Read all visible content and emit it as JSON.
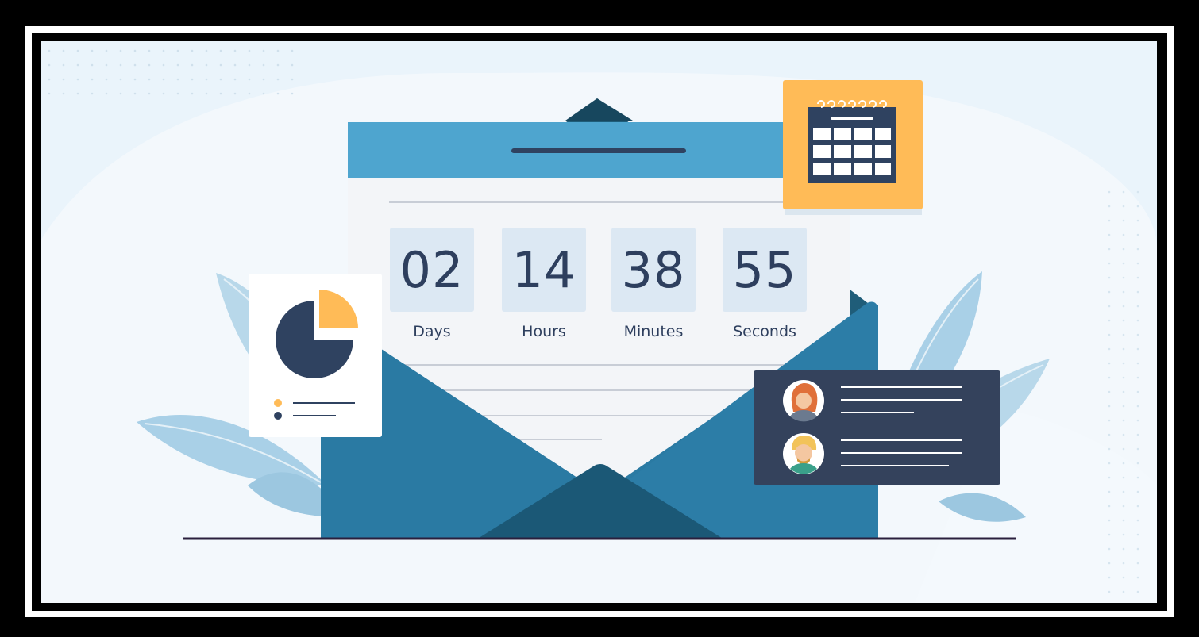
{
  "countdown": {
    "days": {
      "value": "02",
      "label": "Days"
    },
    "hours": {
      "value": "14",
      "label": "Hours"
    },
    "minutes": {
      "value": "38",
      "label": "Minutes"
    },
    "seconds": {
      "value": "55",
      "label": "Seconds"
    }
  },
  "icons": {
    "calendar": "calendar-icon",
    "pie_chart": "pie-chart-icon",
    "avatar_female": "avatar-icon",
    "avatar_male": "avatar-icon",
    "envelope": "envelope-icon"
  },
  "colors": {
    "background": "#eaf4fb",
    "envelope_blue": "#2a7aa3",
    "envelope_dark": "#1b5876",
    "header_blue": "#4ea5cf",
    "calendar_yellow": "#ffbb57",
    "navy": "#2f4260",
    "count_box": "#dce8f3",
    "leaf": "#a9d0e7"
  }
}
